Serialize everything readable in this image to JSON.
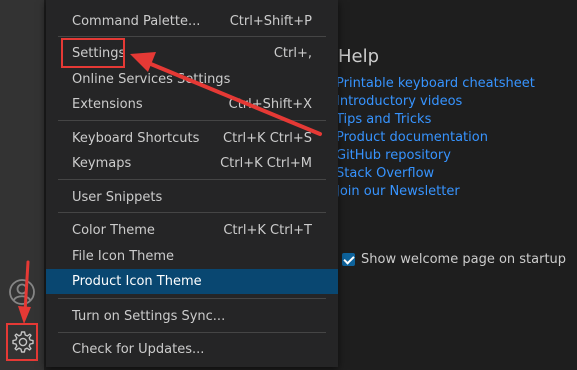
{
  "menu": {
    "items": [
      {
        "label": "Command Palette...",
        "shortcut": "Ctrl+Shift+P"
      },
      {
        "label": "Settings",
        "shortcut": "Ctrl+,"
      },
      {
        "label": "Online Services Settings",
        "shortcut": ""
      },
      {
        "label": "Extensions",
        "shortcut": "Ctrl+Shift+X"
      },
      {
        "label": "Keyboard Shortcuts",
        "shortcut": "Ctrl+K Ctrl+S"
      },
      {
        "label": "Keymaps",
        "shortcut": "Ctrl+K Ctrl+M"
      },
      {
        "label": "User Snippets",
        "shortcut": ""
      },
      {
        "label": "Color Theme",
        "shortcut": "Ctrl+K Ctrl+T"
      },
      {
        "label": "File Icon Theme",
        "shortcut": ""
      },
      {
        "label": "Product Icon Theme",
        "shortcut": ""
      },
      {
        "label": "Turn on Settings Sync...",
        "shortcut": ""
      },
      {
        "label": "Check for Updates...",
        "shortcut": ""
      }
    ]
  },
  "welcome": {
    "help_heading": "Help",
    "links": [
      "Printable keyboard cheatsheet",
      "Introductory videos",
      "Tips and Tricks",
      "Product documentation",
      "GitHub repository",
      "Stack Overflow",
      "Join our Newsletter"
    ],
    "startup_label": "Show welcome page on startup",
    "startup_checked": true
  },
  "activity_bar": {
    "icons": [
      "account-icon",
      "gear-icon"
    ]
  },
  "colors": {
    "menu_bg": "#252526",
    "highlight": "#094771",
    "link": "#3794ff",
    "annotation": "#e53935"
  }
}
